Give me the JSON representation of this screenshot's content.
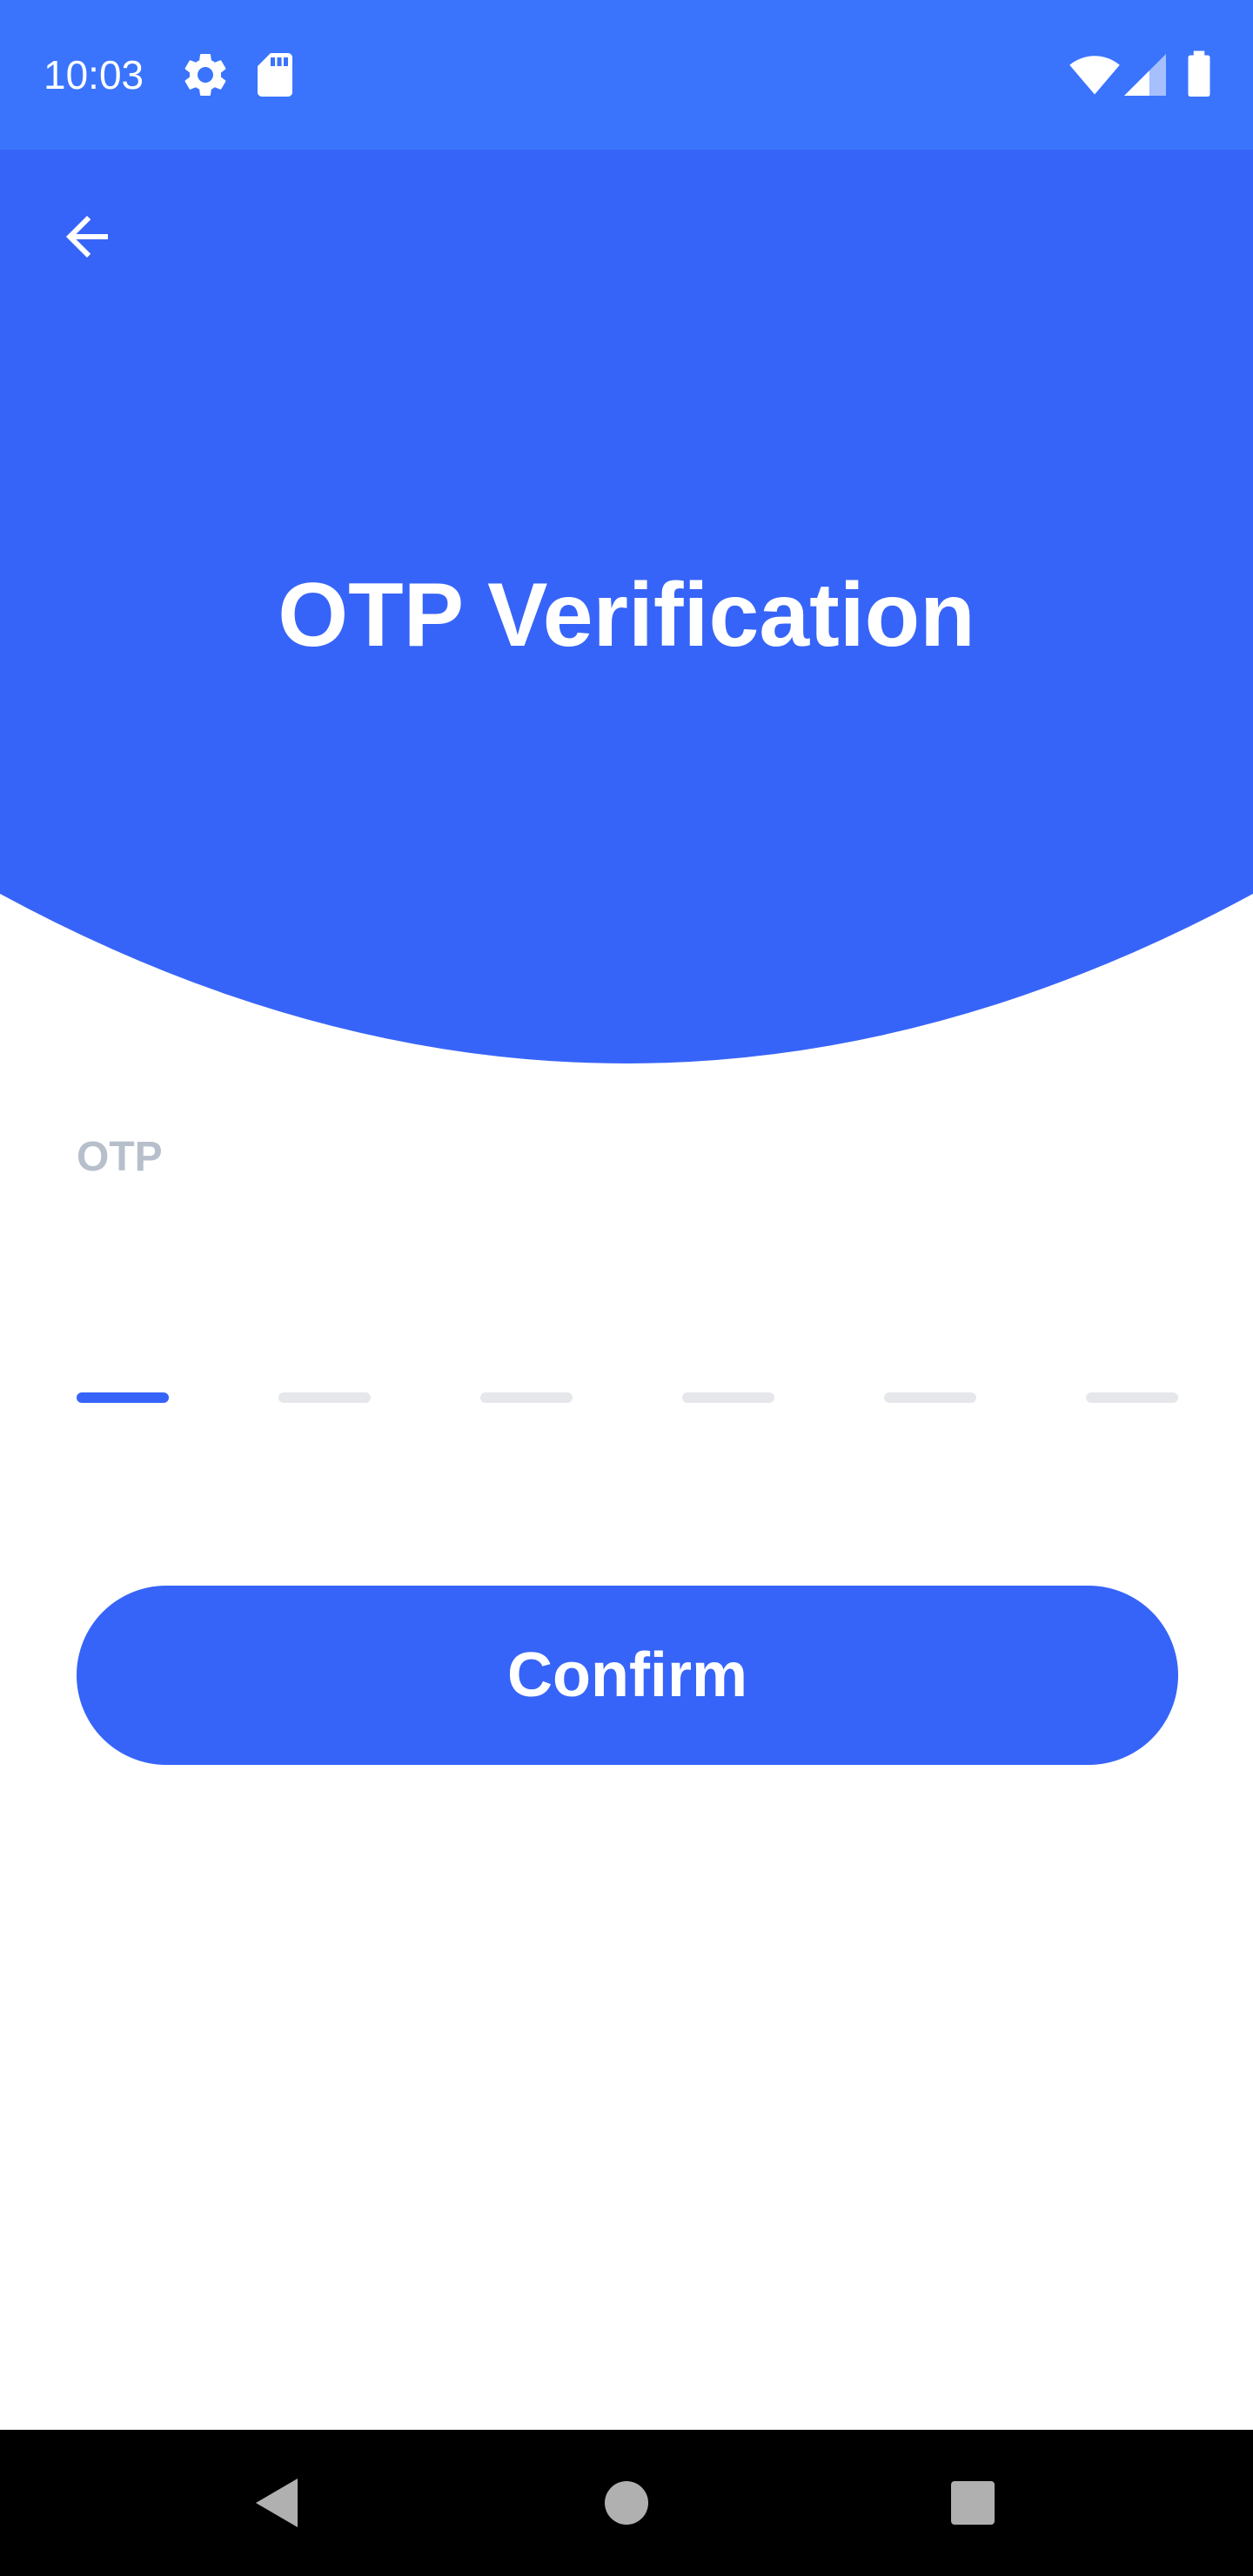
{
  "status_bar": {
    "time": "10:03",
    "left_icons": [
      "gear-icon",
      "sd-card-icon"
    ],
    "right_icons": [
      "wifi-icon",
      "cellular-signal-icon",
      "battery-icon"
    ]
  },
  "header": {
    "back_icon": "arrow-left-icon",
    "title": "OTP Verification"
  },
  "otp": {
    "label": "OTP",
    "digits": [
      "",
      "",
      "",
      "",
      "",
      ""
    ],
    "active_index": 0
  },
  "actions": {
    "confirm_label": "Confirm"
  },
  "nav_bar": {
    "buttons": [
      "back-triangle-icon",
      "home-circle-icon",
      "recents-square-icon"
    ]
  },
  "colors": {
    "status_bar": "#3a74fd",
    "header": "#3764f8",
    "accent": "#3764f8",
    "label_gray": "#b7bfcb",
    "slot_inactive": "#e5e7eb",
    "nav_bar": "#000000"
  }
}
